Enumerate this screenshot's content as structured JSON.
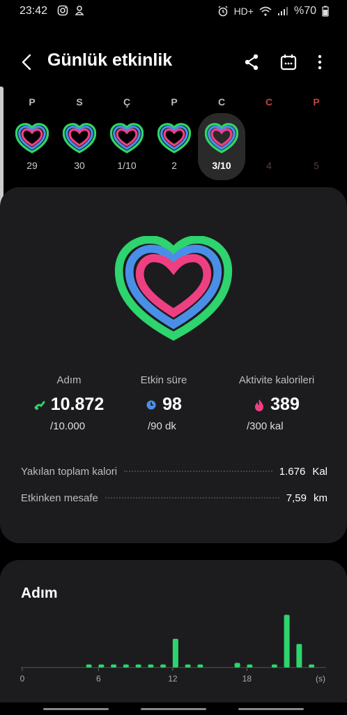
{
  "status": {
    "time": "23:42",
    "network": "HD+",
    "battery": "%70",
    "icons": [
      "instagram-icon",
      "notification-icon",
      "alarm-icon",
      "wifi-icon",
      "signal-icon"
    ]
  },
  "header": {
    "title": "Günlük etkinlik",
    "icons": [
      "back-icon",
      "share-icon",
      "calendar-icon",
      "more-icon"
    ]
  },
  "week": [
    {
      "letter": "P",
      "date": "29",
      "state": "past"
    },
    {
      "letter": "S",
      "date": "30",
      "state": "past"
    },
    {
      "letter": "Ç",
      "date": "1/10",
      "state": "past"
    },
    {
      "letter": "P",
      "date": "2",
      "state": "past"
    },
    {
      "letter": "C",
      "date": "3/10",
      "state": "selected"
    },
    {
      "letter": "C",
      "date": "4",
      "state": "future"
    },
    {
      "letter": "P",
      "date": "5",
      "state": "future"
    }
  ],
  "summary": {
    "steps": {
      "label": "Adım",
      "value": "10.872",
      "goal": "/10.000"
    },
    "active_time": {
      "label": "Etkin süre",
      "value": "98",
      "goal": "/90 dk"
    },
    "calories": {
      "label": "Aktivite kalorileri",
      "value": "389",
      "goal": "/300 kal"
    },
    "total_calories": {
      "label": "Yakılan toplam kalori",
      "value": "1.676",
      "unit": "Kal"
    },
    "distance": {
      "label": "Etkinken mesafe",
      "value": "7,59",
      "unit": "km"
    }
  },
  "steps_card": {
    "title": "Adım"
  },
  "colors": {
    "steps": "#2ed46d",
    "active": "#4a8fe7",
    "calories": "#ef3f83",
    "background": "#000000",
    "card": "#1c1c1e"
  },
  "chart_data": {
    "type": "bar",
    "x": [
      0,
      1,
      2,
      3,
      4,
      5,
      6,
      7,
      8,
      9,
      10,
      11,
      12,
      13,
      14,
      15,
      16,
      17,
      18,
      19,
      20,
      21,
      22,
      23
    ],
    "values": [
      0,
      0,
      0,
      0,
      0,
      60,
      60,
      60,
      60,
      60,
      60,
      60,
      560,
      60,
      60,
      0,
      0,
      90,
      60,
      0,
      60,
      1030,
      460,
      60
    ],
    "xticks": [
      "0",
      "6",
      "12",
      "18",
      "(s)"
    ],
    "ylim": [
      0,
      1200
    ],
    "grid": false
  }
}
